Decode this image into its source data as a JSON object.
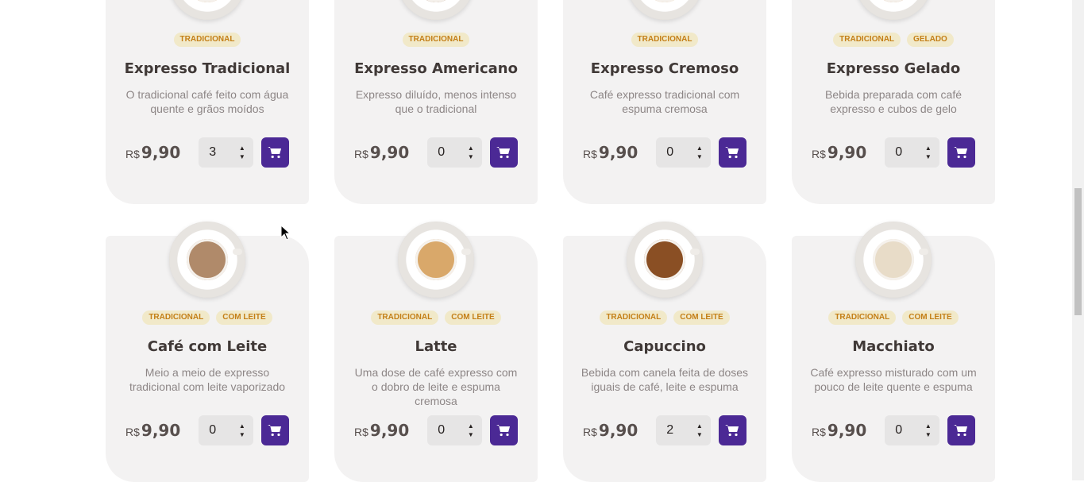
{
  "products": [
    {
      "name": "Expresso Tradicional",
      "description": "O tradicional café feito com água quente e grãos moídos",
      "tags": [
        "TRADICIONAL"
      ],
      "currency": "R$",
      "price": "9,90",
      "quantity": "3",
      "coffee_color": "#c9924e"
    },
    {
      "name": "Expresso Americano",
      "description": "Expresso diluído, menos intenso que o tradicional",
      "tags": [
        "TRADICIONAL"
      ],
      "currency": "R$",
      "price": "9,90",
      "quantity": "0",
      "coffee_color": "#7a4a22"
    },
    {
      "name": "Expresso Cremoso",
      "description": "Café expresso tradicional com espuma cremosa",
      "tags": [
        "TRADICIONAL"
      ],
      "currency": "R$",
      "price": "9,90",
      "quantity": "0",
      "coffee_color": "#d8a560"
    },
    {
      "name": "Expresso Gelado",
      "description": "Bebida preparada com café expresso e cubos de gelo",
      "tags": [
        "TRADICIONAL",
        "GELADO"
      ],
      "currency": "R$",
      "price": "9,90",
      "quantity": "0",
      "coffee_color": "#b9773c"
    },
    {
      "name": "Café com Leite",
      "description": "Meio a meio de expresso tradicional com leite vaporizado",
      "tags": [
        "TRADICIONAL",
        "COM LEITE"
      ],
      "currency": "R$",
      "price": "9,90",
      "quantity": "0",
      "coffee_color": "#b08a6a"
    },
    {
      "name": "Latte",
      "description": "Uma dose de café expresso com o dobro de leite e espuma cremosa",
      "tags": [
        "TRADICIONAL",
        "COM LEITE"
      ],
      "currency": "R$",
      "price": "9,90",
      "quantity": "0",
      "coffee_color": "#d9a86a"
    },
    {
      "name": "Capuccino",
      "description": "Bebida com canela feita de doses iguais de café, leite e espuma",
      "tags": [
        "TRADICIONAL",
        "COM LEITE"
      ],
      "currency": "R$",
      "price": "9,90",
      "quantity": "2",
      "coffee_color": "#8a4f24"
    },
    {
      "name": "Macchiato",
      "description": "Café expresso misturado com um pouco de leite quente e espuma",
      "tags": [
        "TRADICIONAL",
        "COM LEITE"
      ],
      "currency": "R$",
      "price": "9,90",
      "quantity": "0",
      "coffee_color": "#e8dcc8"
    }
  ],
  "icons": {
    "cart": "shopping-cart-icon",
    "increment": "chevron-up-icon",
    "decrement": "chevron-down-icon"
  },
  "colors": {
    "accent": "#4b2995",
    "tag_bg": "#f1e9c9",
    "tag_text": "#c47f17",
    "card_bg": "#f3f2f2"
  }
}
